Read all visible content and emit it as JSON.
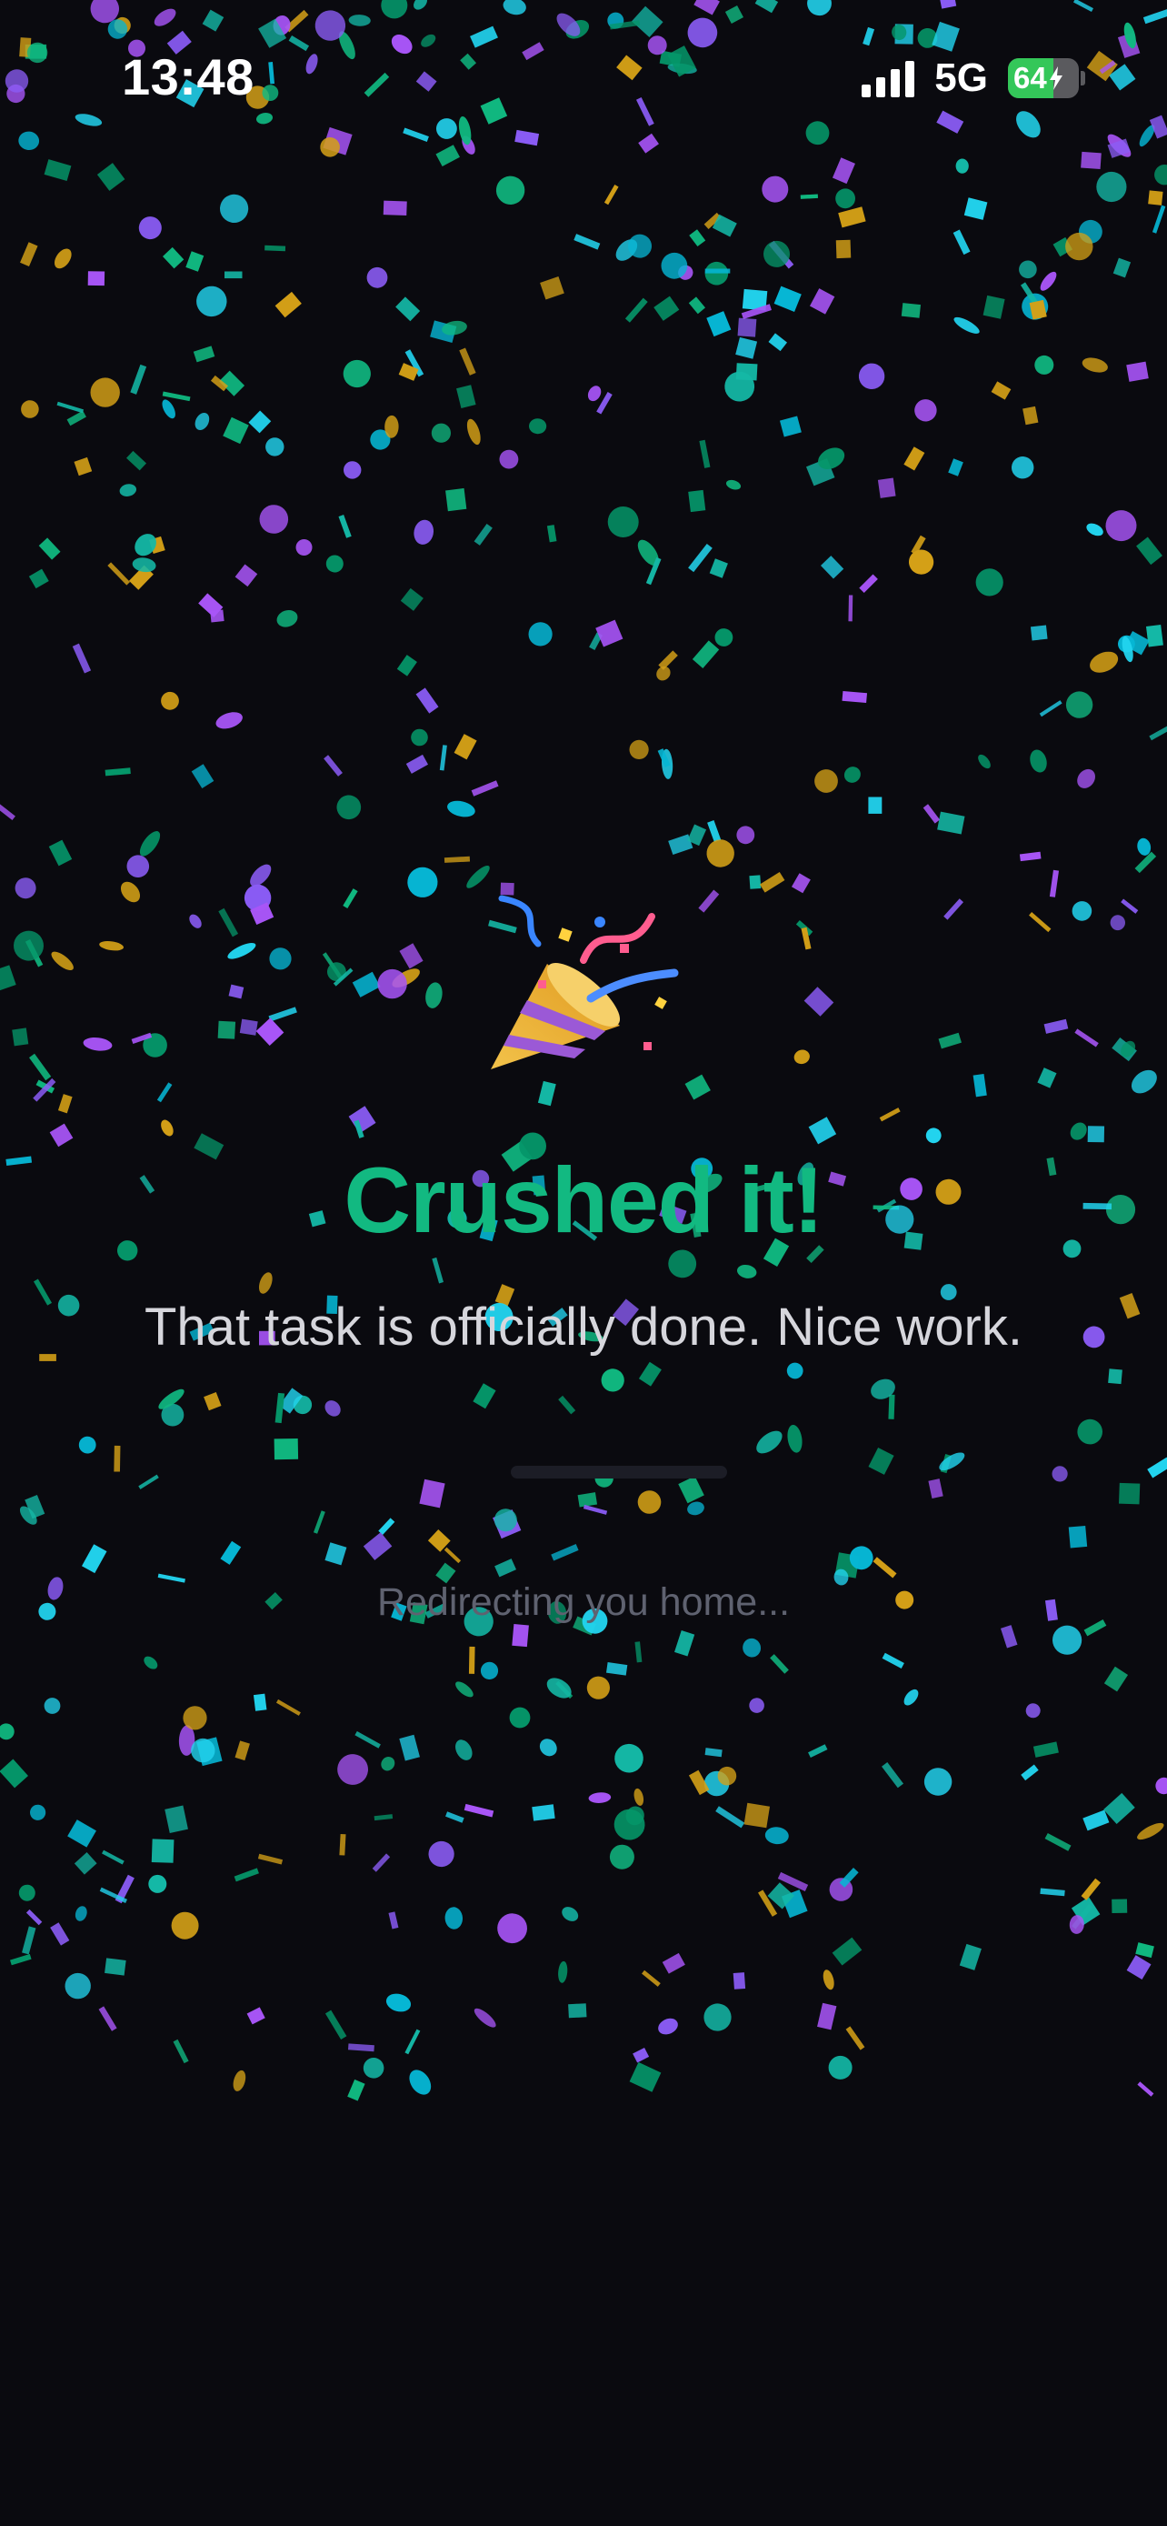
{
  "status_bar": {
    "time": "13:48",
    "network": "5G",
    "battery_percent": "64",
    "battery_level": 0.64,
    "battery_charging": true
  },
  "celebration": {
    "icon": "party-popper-icon",
    "headline": "Crushed it!",
    "subtitle": "That task is officially done. Nice work.",
    "redirect_text": "Redirecting you home...",
    "redirect_progress": 0.0
  },
  "colors": {
    "background": "#0a0a0f",
    "accent": "#12b981",
    "confetti": [
      "#10b981",
      "#8b5cf6",
      "#22d3ee",
      "#14b8a6",
      "#a855f7",
      "#d4a017",
      "#06b6d4",
      "#059669"
    ]
  }
}
